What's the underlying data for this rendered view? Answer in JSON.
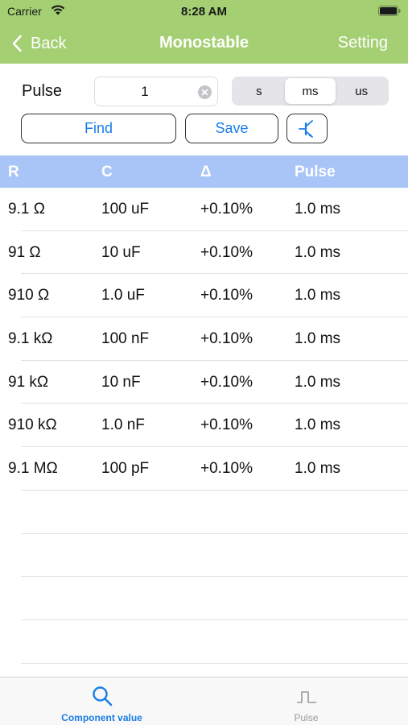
{
  "status_bar": {
    "carrier": "Carrier",
    "time": "8:28 AM",
    "wifi_icon": "wifi-icon",
    "battery_icon": "battery-icon"
  },
  "nav": {
    "back_label": "Back",
    "title": "Monostable",
    "setting_label": "Setting",
    "color": "#a4cf73"
  },
  "controls": {
    "pulse_label": "Pulse",
    "pulse_value": "1",
    "units": [
      "s",
      "ms",
      "us"
    ],
    "selected_unit": "ms",
    "find_label": "Find",
    "save_label": "Save",
    "transistor_icon": "transistor-icon",
    "accent_color": "#1a7ee6"
  },
  "table": {
    "header_color": "#a9c4f7",
    "columns": [
      "R",
      "C",
      "Δ",
      "Pulse"
    ],
    "rows": [
      [
        "9.1 Ω",
        "100 uF",
        "+0.10%",
        "1.0 ms"
      ],
      [
        "91 Ω",
        "10 uF",
        "+0.10%",
        "1.0 ms"
      ],
      [
        "910 Ω",
        "1.0 uF",
        "+0.10%",
        "1.0 ms"
      ],
      [
        "9.1 kΩ",
        "100 nF",
        "+0.10%",
        "1.0 ms"
      ],
      [
        "91 kΩ",
        "10 nF",
        "+0.10%",
        "1.0 ms"
      ],
      [
        "910 kΩ",
        "1.0 nF",
        "+0.10%",
        "1.0 ms"
      ],
      [
        "9.1 MΩ",
        "100 pF",
        "+0.10%",
        "1.0 ms"
      ]
    ]
  },
  "tab_bar": {
    "tabs": [
      {
        "label": "Component value",
        "icon": "search-icon",
        "selected": true
      },
      {
        "label": "Pulse",
        "icon": "pulse-icon",
        "selected": false
      }
    ]
  }
}
